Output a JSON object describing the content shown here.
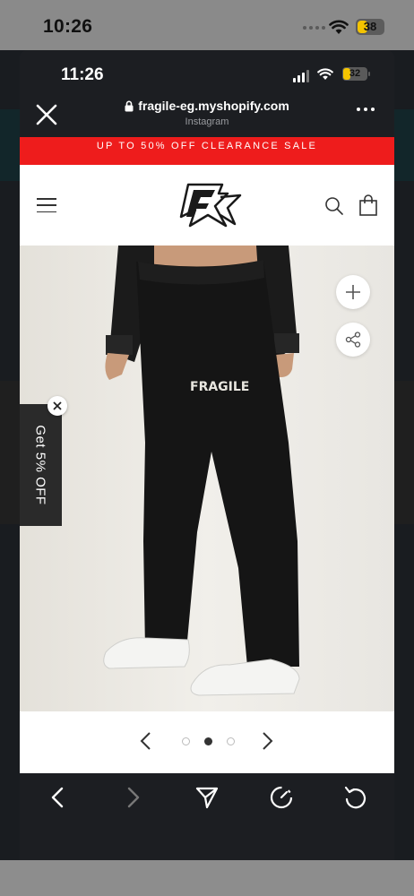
{
  "outer_status": {
    "time": "10:26",
    "battery": "38",
    "battery_level": 0.38
  },
  "browser": {
    "status": {
      "time": "11:26",
      "battery": "32",
      "battery_level": 0.32
    },
    "url": "fragile-eg.myshopify.com",
    "source_label": "Instagram",
    "icons": {
      "close": "close-icon",
      "lock": "lock-icon",
      "more": "more-options-icon",
      "back": "back-arrow-icon",
      "forward": "forward-arrow-icon",
      "share": "send-icon",
      "speed": "speedometer-icon",
      "reload": "reload-icon"
    }
  },
  "site": {
    "promo_banner": "UP TO 50% OFF CLEARANCE SALE",
    "icons": {
      "menu": "hamburger-menu-icon",
      "logo": "fragile-star-logo",
      "search": "search-icon",
      "cart": "shopping-bag-icon"
    },
    "product": {
      "garment_print": "FRAGILE",
      "zoom_icon": "plus-icon",
      "share_icon": "share-icon",
      "gallery": {
        "slide_count": 3,
        "active_index": 1
      }
    },
    "discount_tab": {
      "label": "Get 5% OFF",
      "close_icon": "close-icon"
    }
  },
  "colors": {
    "promo_red": "#ee1c1c",
    "browser_chrome": "#1c1e22",
    "battery_yellow": "#f4c400"
  }
}
